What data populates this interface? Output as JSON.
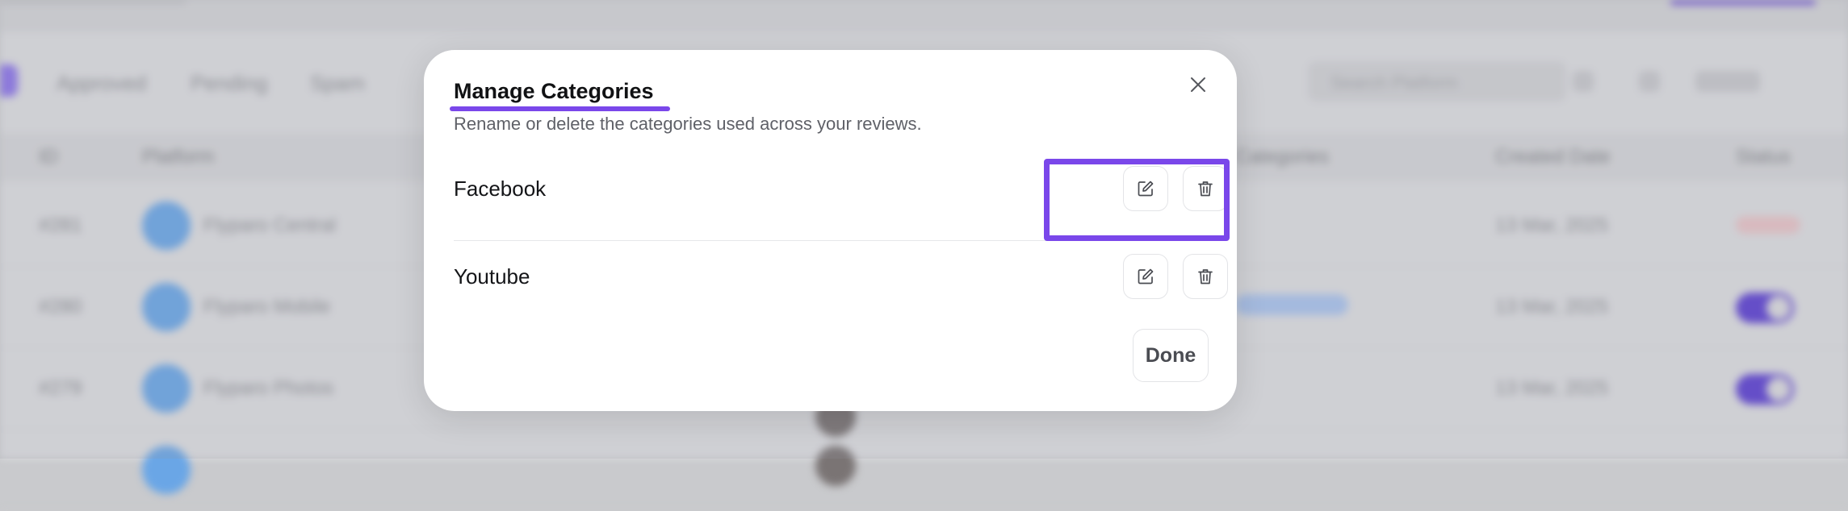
{
  "background": {
    "tabs": [
      "Approved",
      "Pending",
      "Spam"
    ],
    "search_placeholder": "Search Platform",
    "columns": [
      "ID",
      "Platform",
      "Categories",
      "Created Date",
      "Status"
    ],
    "rows": [
      {
        "id": "#281",
        "name": "Flyparo Central",
        "date": "13 Mar, 2025"
      },
      {
        "id": "#280",
        "name": "Flyparo Mobile",
        "date": "13 Mar, 2025"
      },
      {
        "id": "#279",
        "name": "Flyparo Photos",
        "date": "13 Mar, 2025"
      }
    ]
  },
  "modal": {
    "title": "Manage Categories",
    "subtitle": "Rename or delete the categories used across your reviews.",
    "categories": [
      {
        "name": "Facebook"
      },
      {
        "name": "Youtube"
      }
    ],
    "done_label": "Done"
  },
  "icons": {
    "close": "close-icon",
    "edit": "edit-icon",
    "delete": "trash-icon"
  },
  "colors": {
    "accent": "#7a47ea",
    "annotation": "#7a47ea"
  }
}
